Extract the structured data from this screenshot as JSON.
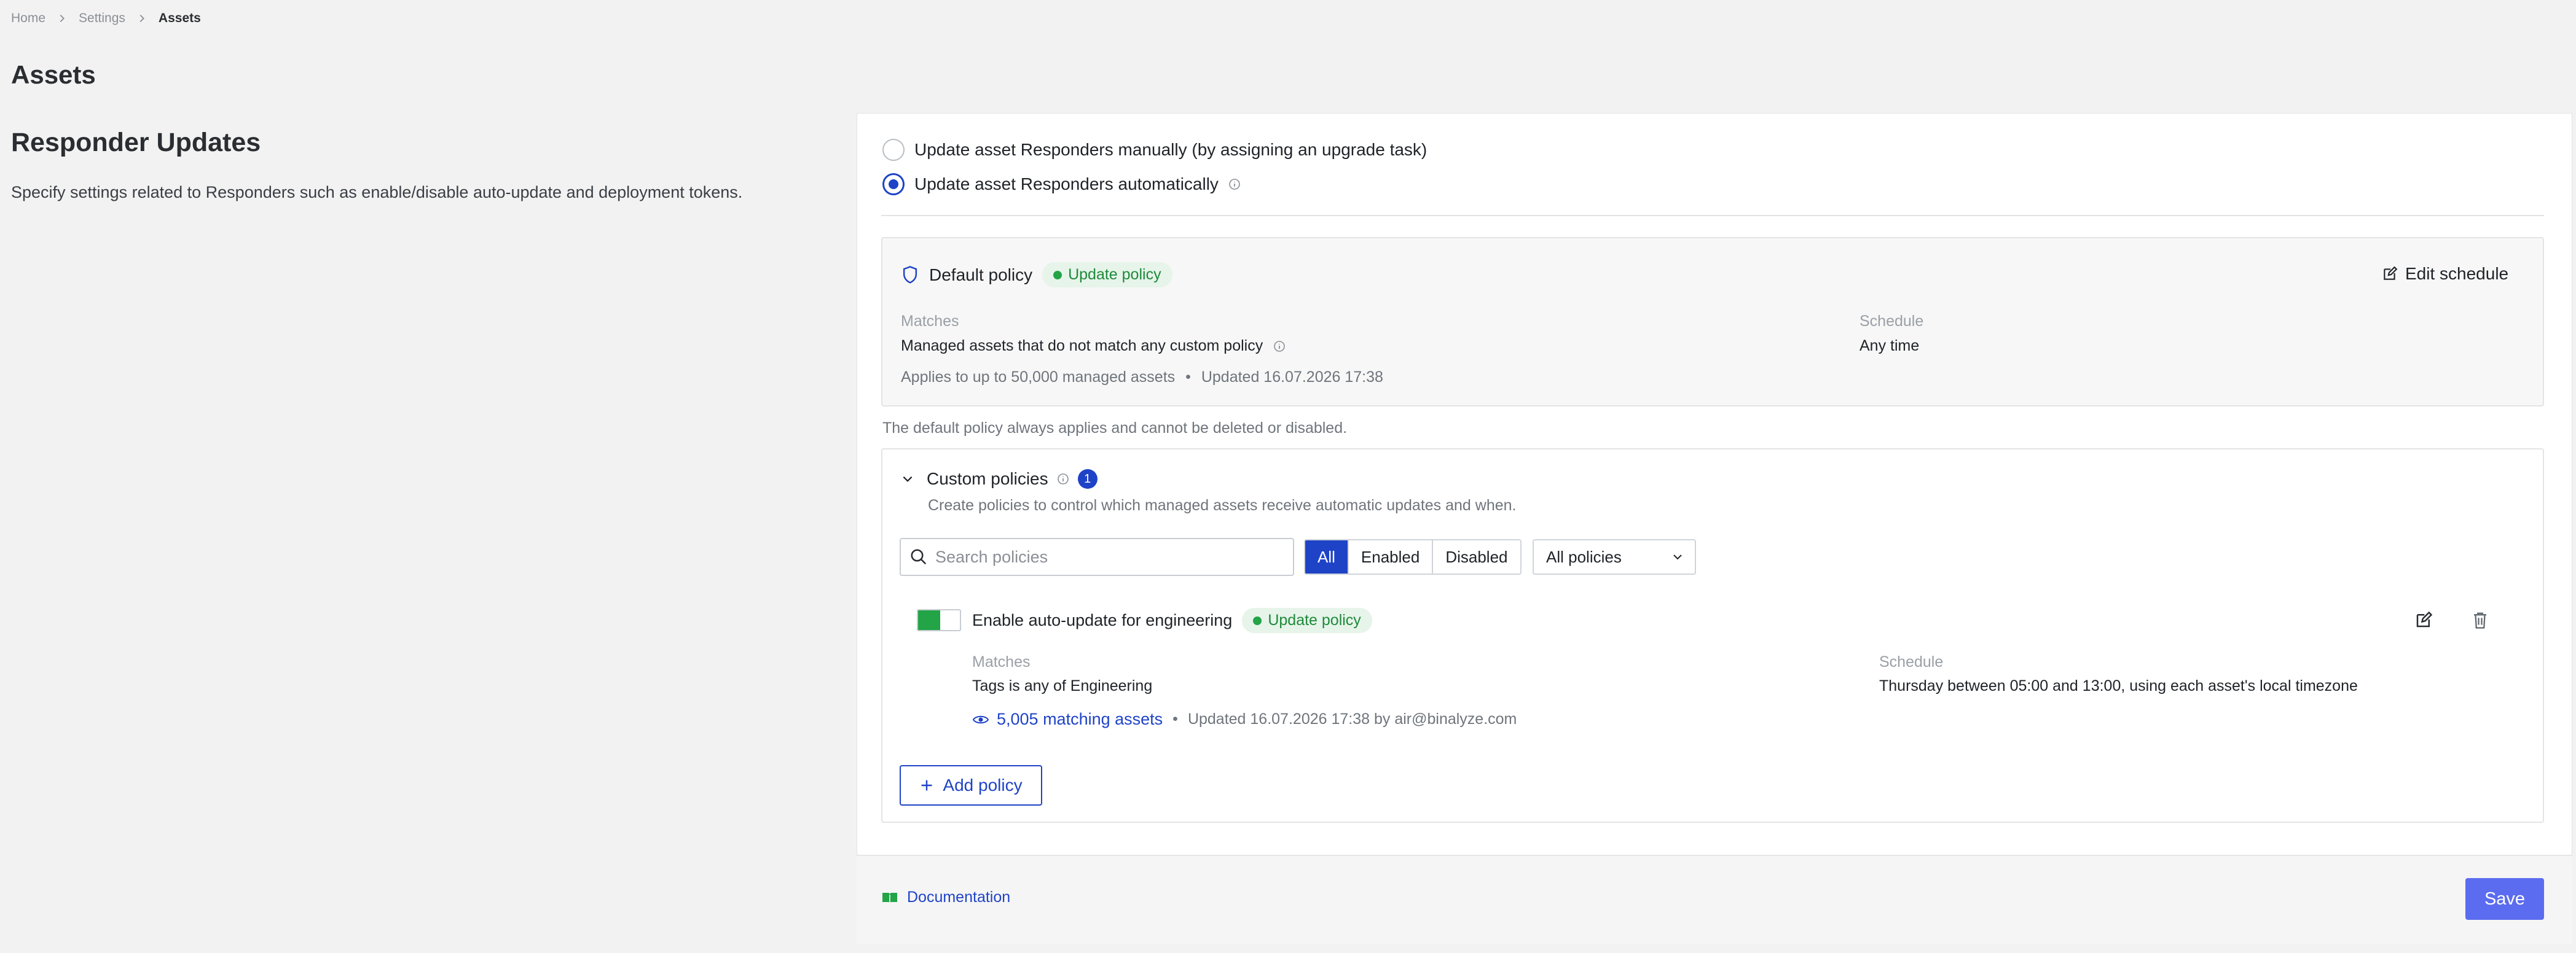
{
  "breadcrumb": {
    "home": "Home",
    "settings": "Settings",
    "current": "Assets"
  },
  "page_title": "Assets",
  "section": {
    "title": "Responder Updates",
    "description": "Specify settings related to Responders such as enable/disable auto-update and deployment tokens."
  },
  "update_mode": {
    "manual_label": "Update asset Responders manually (by assigning an upgrade task)",
    "auto_label": "Update asset Responders automatically",
    "selected": "auto"
  },
  "default_policy": {
    "title": "Default policy",
    "badge": "Update policy",
    "edit_label": "Edit schedule",
    "matches_label": "Matches",
    "matches_value": "Managed assets that do not match any custom policy",
    "schedule_label": "Schedule",
    "schedule_value": "Any time",
    "applies": "Applies to up to 50,000 managed assets",
    "bullet": "•",
    "updated": "Updated 16.07.2026 17:38",
    "note": "The default policy always applies and cannot be deleted or disabled."
  },
  "custom_policies": {
    "title": "Custom policies",
    "count": "1",
    "description": "Create policies to control which managed assets receive automatic updates and when.",
    "search_placeholder": "Search policies",
    "filters": [
      "All",
      "Enabled",
      "Disabled"
    ],
    "active_filter": "All",
    "select_value": "All policies",
    "add_label": "Add policy",
    "items": [
      {
        "name": "Enable auto-update for engineering",
        "enabled": true,
        "badge": "Update policy",
        "matches_label": "Matches",
        "matches_value": "Tags is any of Engineering",
        "schedule_label": "Schedule",
        "schedule_value": "Thursday between 05:00 and 13:00, using each asset's local timezone",
        "matching_assets": "5,005 matching assets",
        "bullet": "•",
        "updated": "Updated 16.07.2026 17:38 by air@binalyze.com"
      }
    ]
  },
  "footer": {
    "documentation": "Documentation",
    "save": "Save"
  },
  "colors": {
    "accent": "#1f43c7",
    "save": "#5b6cf0",
    "success": "#22a447"
  }
}
